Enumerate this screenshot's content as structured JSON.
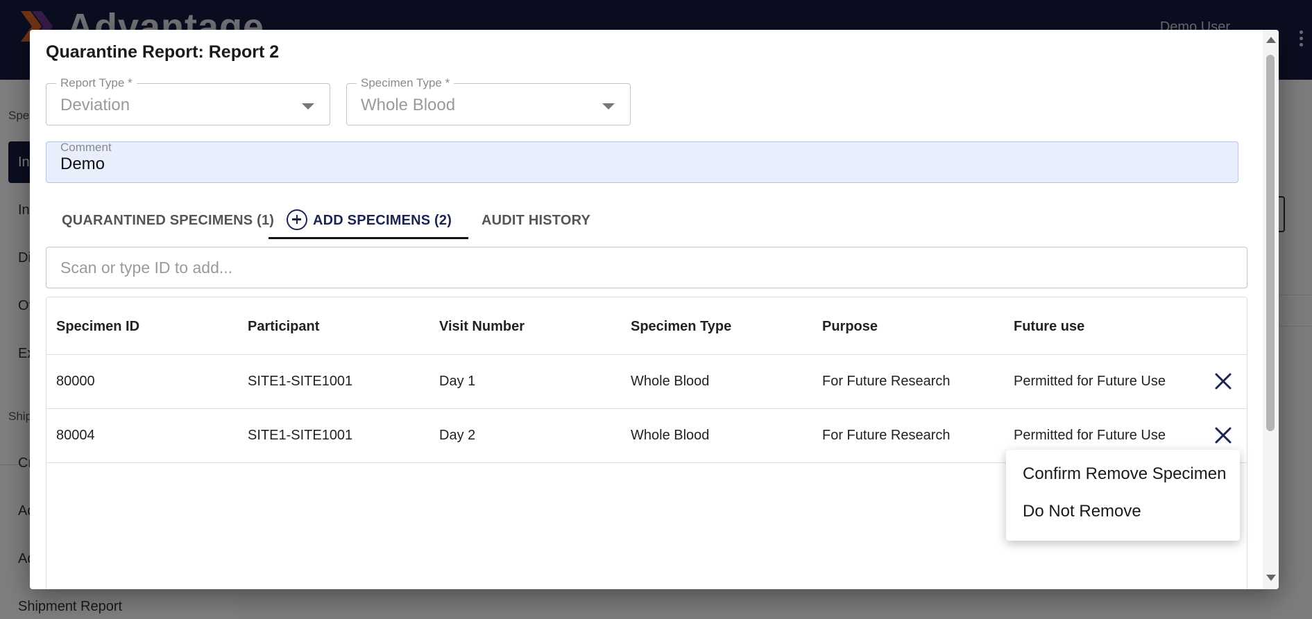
{
  "app": {
    "brand": "Advantage",
    "user": "Demo User",
    "colors": {
      "primary": "#161d41",
      "accent": "#1c2452",
      "comment_bg": "#e8eefc"
    }
  },
  "sidebar": {
    "group1": "Spec",
    "items": [
      "In",
      "In",
      "Di",
      "Ot",
      "Ex"
    ],
    "group2": "Shipm",
    "items2": [
      "Cr",
      "Ad",
      "Ad",
      "Shipment Report"
    ]
  },
  "background": {
    "link_fragment": "y"
  },
  "dialog": {
    "title": "Quarantine Report: Report 2",
    "report_type": {
      "label": "Report Type *",
      "value": "Deviation"
    },
    "specimen_type": {
      "label": "Specimen Type *",
      "value": "Whole Blood"
    },
    "comment": {
      "label": "Comment",
      "value": "Demo"
    },
    "tabs": [
      {
        "label": "QUARANTINED SPECIMENS (1)"
      },
      {
        "label": "ADD SPECIMENS (2)",
        "icon": "add-circle-icon",
        "active": true
      },
      {
        "label": "AUDIT HISTORY"
      }
    ],
    "scan_placeholder": "Scan or type ID to add...",
    "table": {
      "columns": [
        "Specimen ID",
        "Participant",
        "Visit Number",
        "Specimen Type",
        "Purpose",
        "Future use"
      ],
      "rows": [
        [
          "80000",
          "SITE1-SITE1001",
          "Day 1",
          "Whole Blood",
          "For Future Research",
          "Permitted for Future Use"
        ],
        [
          "80004",
          "SITE1-SITE1001",
          "Day 2",
          "Whole Blood",
          "For Future Research",
          "Permitted for Future Use"
        ]
      ]
    },
    "menu": {
      "items": [
        "Confirm Remove Specimen",
        "Do Not Remove"
      ]
    }
  }
}
